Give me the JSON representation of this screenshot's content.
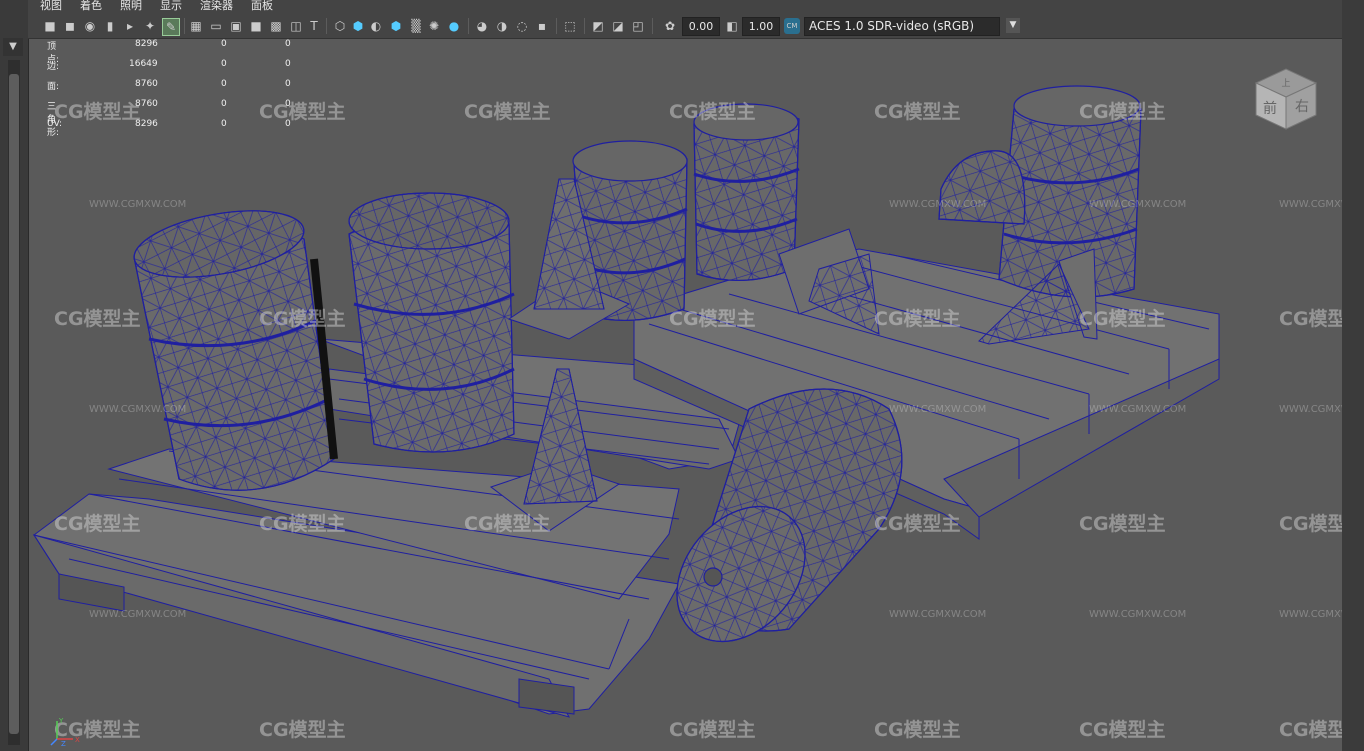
{
  "menu": [
    "视图",
    "着色",
    "照明",
    "显示",
    "渲染器",
    "面板"
  ],
  "toolbar": {
    "exposure": "0.00",
    "gamma": "1.00",
    "colorspace": "ACES 1.0 SDR-video (sRGB)",
    "icons": [
      "camera-icon",
      "camera-attrs-icon",
      "bookmark-icon",
      "image-plane-icon",
      "grid-icon",
      "film-gate-icon",
      "resolution-gate-icon",
      "gate-mask-icon",
      "field-chart-icon",
      "safe-action-icon",
      "safe-title-icon",
      "wireframe-icon",
      "smooth-shade-icon",
      "textured-icon",
      "use-lights-icon",
      "shadows-icon",
      "xray-icon",
      "isolate-icon",
      "aa-icon",
      "ambient-occlusion-icon",
      "motion-blur-icon",
      "gamma-icon"
    ]
  },
  "hud": {
    "rows": [
      {
        "label": "顶点:",
        "a": "8296",
        "b": "0",
        "c": "0"
      },
      {
        "label": "边:",
        "a": "16649",
        "b": "0",
        "c": "0"
      },
      {
        "label": "面:",
        "a": "8760",
        "b": "0",
        "c": "0"
      },
      {
        "label": "三角形:",
        "a": "8760",
        "b": "0",
        "c": "0"
      },
      {
        "label": "UV:",
        "a": "8296",
        "b": "0",
        "c": "0"
      }
    ]
  },
  "viewcube": {
    "front": "前",
    "right": "右",
    "top": "上"
  },
  "watermark": {
    "logo": "CG模型主",
    "url": "WWW.CGMXW.COM"
  },
  "axis": {
    "x": "X",
    "y": "Y",
    "z": "Z"
  },
  "colors": {
    "viewport": "#5a5a5a",
    "wire": "#1f1fa0",
    "mesh_face": "#6e6e6e",
    "mesh_dark": "#4a4a4a"
  }
}
